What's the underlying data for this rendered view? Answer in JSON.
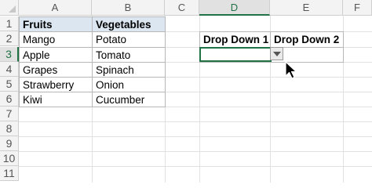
{
  "columns": [
    "A",
    "B",
    "C",
    "D",
    "E",
    "F"
  ],
  "rows": [
    "1",
    "2",
    "3",
    "4",
    "5",
    "6",
    "7",
    "8",
    "9",
    "10",
    "11"
  ],
  "table": {
    "headers": [
      "Fruits",
      "Vegetables"
    ],
    "rows": [
      [
        "Mango",
        "Potato"
      ],
      [
        "Apple",
        "Tomato"
      ],
      [
        "Grapes",
        "Spinach"
      ],
      [
        "Strawberry",
        "Onion"
      ],
      [
        "Kiwi",
        "Cucumber"
      ]
    ]
  },
  "dropdowns": {
    "header1": "Drop Down 1",
    "header2": "Drop Down 2",
    "value1": "",
    "value2": ""
  },
  "icons": {
    "dropdown": "chevron-down-icon",
    "cursor": "mouse-pointer-icon",
    "select_all": "select-all-corner-icon"
  },
  "colors": {
    "header_fill": "#dce6f1",
    "selection_accent": "#217346"
  }
}
